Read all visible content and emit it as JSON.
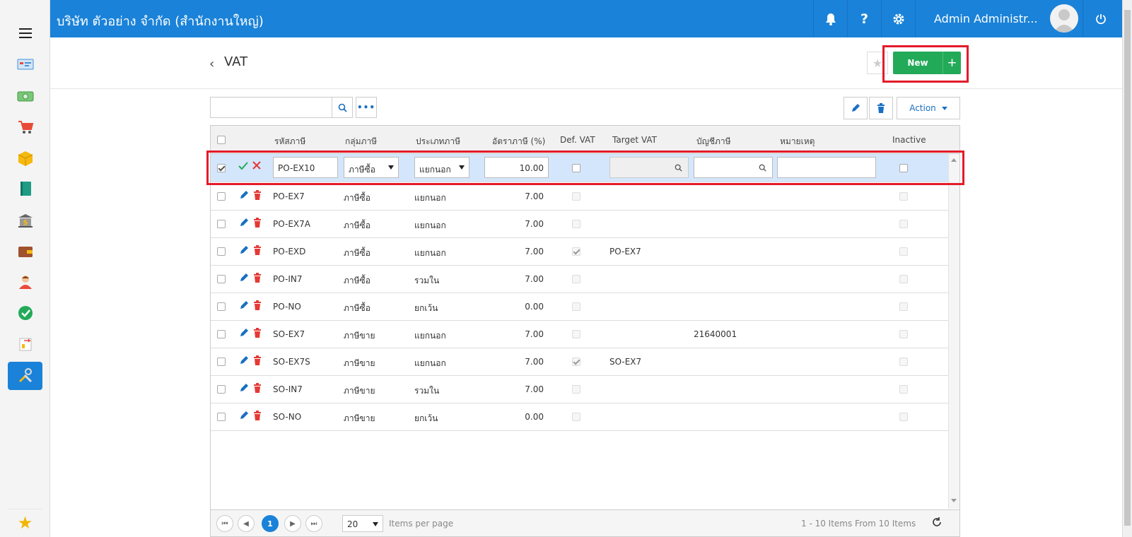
{
  "app": {
    "company": "บริษัท ตัวอย่าง จำกัด (สำนักงานใหญ่)",
    "user": "Admin Administr...",
    "icons": [
      "bell-icon",
      "help-icon",
      "gear-icon",
      "power-icon"
    ]
  },
  "sidebar": {
    "items": [
      {
        "name": "dashboard-icon"
      },
      {
        "name": "money-icon"
      },
      {
        "name": "cart-icon"
      },
      {
        "name": "box-icon"
      },
      {
        "name": "book-icon"
      },
      {
        "name": "bank-icon"
      },
      {
        "name": "wallet-icon"
      },
      {
        "name": "person-icon"
      },
      {
        "name": "check-circle-icon"
      },
      {
        "name": "transfer-icon"
      },
      {
        "name": "tools-icon",
        "active": true
      }
    ],
    "favorite": "★"
  },
  "page": {
    "title": "VAT",
    "back": "‹",
    "new_label": "New",
    "new_plus": "+"
  },
  "toolbar": {
    "search_value": "",
    "more": "•••",
    "action_label": "Action"
  },
  "grid": {
    "columns": [
      "รหัสภาษี",
      "กลุ่มภาษี",
      "ประเภทภาษี",
      "อัตราภาษี (%)",
      "Def. VAT",
      "Target VAT",
      "บัญชีภาษี",
      "หมายเหตุ",
      "Inactive"
    ],
    "edit_row": {
      "checked": true,
      "code": "PO-EX10",
      "group": "ภาษีซื้อ",
      "type": "แยกนอก",
      "rate": "10.00",
      "def_vat": false,
      "target_vat": "",
      "account": "",
      "remark": "",
      "inactive": false
    },
    "rows": [
      {
        "code": "PO-EX7",
        "group": "ภาษีซื้อ",
        "type": "แยกนอก",
        "rate": "7.00",
        "def_vat": false,
        "target_vat": "",
        "account": "",
        "remark": ""
      },
      {
        "code": "PO-EX7A",
        "group": "ภาษีซื้อ",
        "type": "แยกนอก",
        "rate": "7.00",
        "def_vat": false,
        "target_vat": "",
        "account": "",
        "remark": ""
      },
      {
        "code": "PO-EXD",
        "group": "ภาษีซื้อ",
        "type": "แยกนอก",
        "rate": "7.00",
        "def_vat": true,
        "target_vat": "PO-EX7",
        "account": "",
        "remark": ""
      },
      {
        "code": "PO-IN7",
        "group": "ภาษีซื้อ",
        "type": "รวมใน",
        "rate": "7.00",
        "def_vat": false,
        "target_vat": "",
        "account": "",
        "remark": ""
      },
      {
        "code": "PO-NO",
        "group": "ภาษีซื้อ",
        "type": "ยกเว้น",
        "rate": "0.00",
        "def_vat": false,
        "target_vat": "",
        "account": "",
        "remark": ""
      },
      {
        "code": "SO-EX7",
        "group": "ภาษีขาย",
        "type": "แยกนอก",
        "rate": "7.00",
        "def_vat": false,
        "target_vat": "",
        "account": "21640001",
        "remark": ""
      },
      {
        "code": "SO-EX7S",
        "group": "ภาษีขาย",
        "type": "แยกนอก",
        "rate": "7.00",
        "def_vat": true,
        "target_vat": "SO-EX7",
        "account": "",
        "remark": ""
      },
      {
        "code": "SO-IN7",
        "group": "ภาษีขาย",
        "type": "รวมใน",
        "rate": "7.00",
        "def_vat": false,
        "target_vat": "",
        "account": "",
        "remark": ""
      },
      {
        "code": "SO-NO",
        "group": "ภาษีขาย",
        "type": "ยกเว้น",
        "rate": "0.00",
        "def_vat": false,
        "target_vat": "",
        "account": "",
        "remark": ""
      }
    ]
  },
  "pager": {
    "current": "1",
    "page_size": "20",
    "items_per_page": "Items per page",
    "summary": "1 - 10 Items From 10 Items"
  },
  "colors": {
    "primary": "#1a82d8",
    "new_button": "#22aa59",
    "highlight": "#e31b2a",
    "edit_row": "#d4e6fb",
    "delete": "#e53935",
    "pencil": "#1a6fc2"
  }
}
